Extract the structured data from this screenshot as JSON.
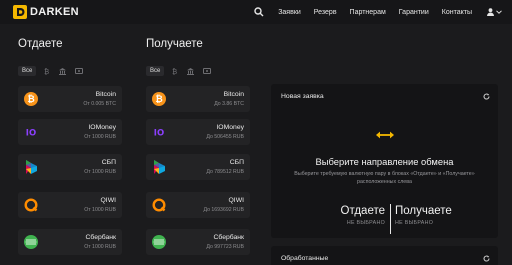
{
  "header": {
    "logo_text": "DARKEN",
    "nav": [
      "Заявки",
      "Резерв",
      "Партнерам",
      "Гарантии",
      "Контакты"
    ]
  },
  "give": {
    "title": "Отдаете",
    "filter_all": "Все",
    "items": [
      {
        "name": "Bitcoin",
        "sub": "От 0.005 BTC",
        "icon": "bitcoin-icon"
      },
      {
        "name": "IOMoney",
        "sub": "От 1000 RUB",
        "icon": "iomoney-icon"
      },
      {
        "name": "СБП",
        "sub": "От 1000 RUB",
        "icon": "sbp-icon"
      },
      {
        "name": "QIWI",
        "sub": "От 1000 RUB",
        "icon": "qiwi-icon"
      },
      {
        "name": "Сбербанк",
        "sub": "От 1000 RUB",
        "icon": "sberbank-icon"
      }
    ]
  },
  "get": {
    "title": "Получаете",
    "filter_all": "Все",
    "items": [
      {
        "name": "Bitcoin",
        "sub": "До 3.86 BTC",
        "icon": "bitcoin-icon"
      },
      {
        "name": "IOMoney",
        "sub": "До 506455 RUB",
        "icon": "iomoney-icon"
      },
      {
        "name": "СБП",
        "sub": "До 789512 RUB",
        "icon": "sbp-icon"
      },
      {
        "name": "QIWI",
        "sub": "До 1693692 RUB",
        "icon": "qiwi-icon"
      },
      {
        "name": "Сбербанк",
        "sub": "До 997723 RUB",
        "icon": "sberbank-icon"
      }
    ]
  },
  "panel": {
    "title": "Новая заявка",
    "heading": "Выберите направление обмена",
    "description": "Выберите требуемую валютную пару в блоках «Отдаете» и «Получаете» расположенных слева",
    "give_label": "Отдаете",
    "give_status": "НЕ ВЫБРАНО",
    "get_label": "Получаете",
    "get_status": "НЕ ВЫБРАНО"
  },
  "processed": {
    "title": "Обработанные"
  },
  "colors": {
    "accent": "#f5b800",
    "background": "#1b1b1d",
    "card": "#232325",
    "panel": "#141416"
  }
}
